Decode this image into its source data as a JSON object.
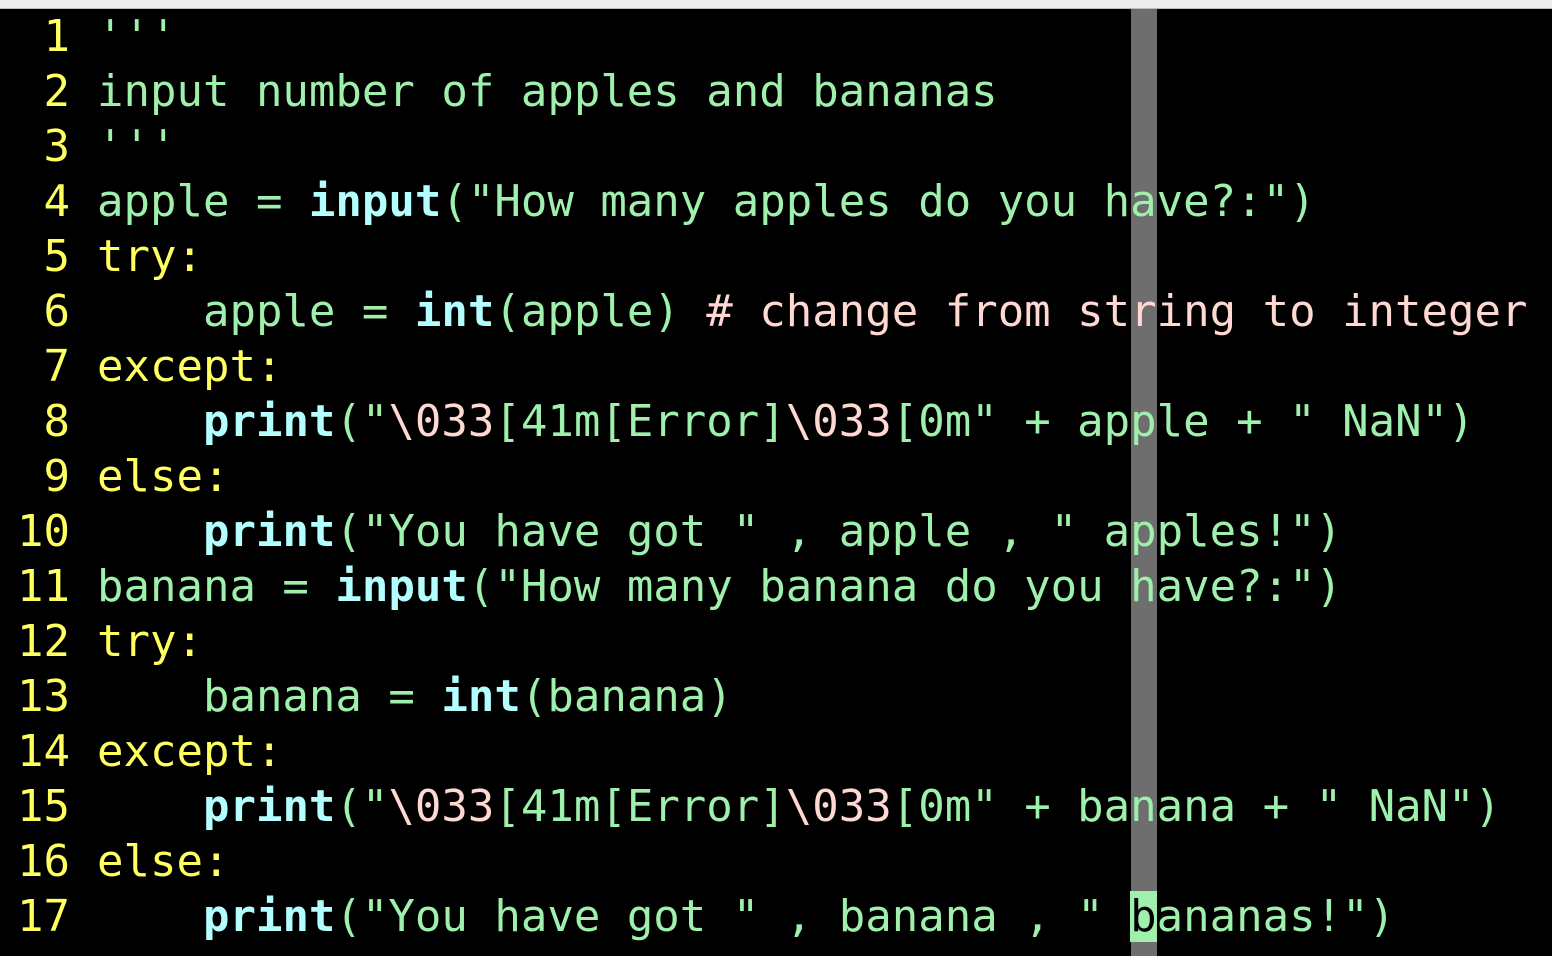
{
  "colors": {
    "line_number": "#ffff60",
    "default": "#9ff0ad",
    "keyword": "#ffff60",
    "builtin": "#b3ffff",
    "comment": "#ffd8d2",
    "color_column": "#6e6e6e",
    "cursor": "#9ff0ad"
  },
  "editor": {
    "color_column": 40,
    "cursor": {
      "line": 17,
      "column": 28
    },
    "lines": [
      {
        "n": "1",
        "segs": [
          [
            "str",
            "'''"
          ]
        ]
      },
      {
        "n": "2",
        "segs": [
          [
            "str",
            "input number of apples and bananas"
          ]
        ]
      },
      {
        "n": "3",
        "segs": [
          [
            "str",
            "'''"
          ]
        ]
      },
      {
        "n": "4",
        "segs": [
          [
            "str",
            "apple = "
          ],
          [
            "fn",
            "input"
          ],
          [
            "str",
            "(\"How many apples do you have?:\")"
          ]
        ]
      },
      {
        "n": "5",
        "segs": [
          [
            "kw",
            "try:"
          ]
        ]
      },
      {
        "n": "6",
        "segs": [
          [
            "str",
            "    apple = "
          ],
          [
            "fn",
            "int"
          ],
          [
            "str",
            "(apple) "
          ],
          [
            "cm",
            "# change from string to integer"
          ]
        ]
      },
      {
        "n": "7",
        "segs": [
          [
            "kw",
            "except:"
          ]
        ]
      },
      {
        "n": "8",
        "segs": [
          [
            "str",
            "    "
          ],
          [
            "fn",
            "print"
          ],
          [
            "str",
            "(\""
          ],
          [
            "esc",
            "\\033"
          ],
          [
            "str",
            "[41m[Error]"
          ],
          [
            "esc",
            "\\033"
          ],
          [
            "str",
            "[0m\" + apple + \" NaN\")"
          ]
        ]
      },
      {
        "n": "9",
        "segs": [
          [
            "kw",
            "else:"
          ]
        ]
      },
      {
        "n": "10",
        "segs": [
          [
            "str",
            "    "
          ],
          [
            "fn",
            "print"
          ],
          [
            "str",
            "(\"You have got \" , apple , \" apples!\")"
          ]
        ]
      },
      {
        "n": "11",
        "segs": [
          [
            "str",
            "banana = "
          ],
          [
            "fn",
            "input"
          ],
          [
            "str",
            "(\"How many banana do you have?:\")"
          ]
        ]
      },
      {
        "n": "12",
        "segs": [
          [
            "kw",
            "try:"
          ]
        ]
      },
      {
        "n": "13",
        "segs": [
          [
            "str",
            "    banana = "
          ],
          [
            "fn",
            "int"
          ],
          [
            "str",
            "(banana)"
          ]
        ]
      },
      {
        "n": "14",
        "segs": [
          [
            "kw",
            "except:"
          ]
        ]
      },
      {
        "n": "15",
        "segs": [
          [
            "str",
            "    "
          ],
          [
            "fn",
            "print"
          ],
          [
            "str",
            "(\""
          ],
          [
            "esc",
            "\\033"
          ],
          [
            "str",
            "[41m[Error]"
          ],
          [
            "esc",
            "\\033"
          ],
          [
            "str",
            "[0m\" + banana + \" NaN\")"
          ]
        ]
      },
      {
        "n": "16",
        "segs": [
          [
            "kw",
            "else:"
          ]
        ]
      },
      {
        "n": "17",
        "segs": [
          [
            "str",
            "    "
          ],
          [
            "fn",
            "print"
          ],
          [
            "str",
            "(\"You have got \" , banana , \" "
          ],
          [
            "cur",
            "b"
          ],
          [
            "str",
            "ananas!\")"
          ]
        ]
      }
    ]
  }
}
